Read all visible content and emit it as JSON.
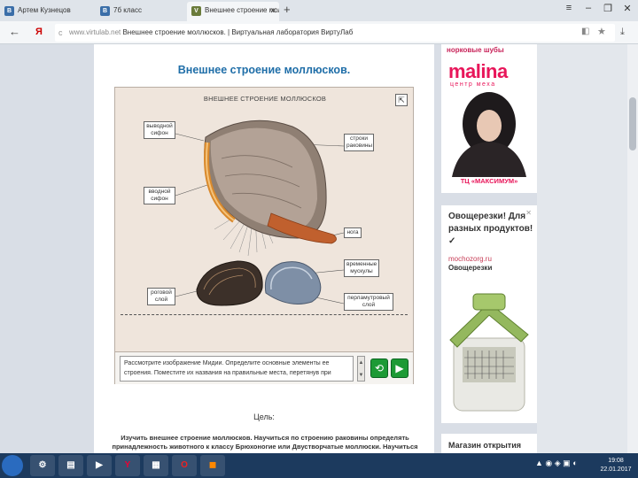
{
  "browser": {
    "tabs": [
      {
        "label": "Артем Кузнецов"
      },
      {
        "label": "7б класс"
      },
      {
        "label": "Внешнее строение молл"
      }
    ],
    "new_tab": "+",
    "url_domain": "www.virtulab.net",
    "url_rest": " Внешнее строение моллюсков. | Виртуальная лаборатория ВиртуЛаб"
  },
  "page": {
    "title": "Внешнее строение моллюсков.",
    "lab": {
      "heading": "ВНЕШНЕЕ СТРОЕНИЕ МОЛЛЮСКОВ",
      "labels": {
        "exhalant": "выводной\nсифон",
        "inhalant": "вводной\nсифон",
        "growth_lines": "строки\nраковины",
        "foot": "нога",
        "muscles": "временные\nмускулы",
        "horny": "роговой\nслой",
        "pearl": "перламутровый\nслой"
      },
      "instruction": "Рассмотрите изображение Мидии. Определите основные элементы ее строения. Поместите их названия на правильные места, перетянув при"
    },
    "goal": "Цель:",
    "task": "Изучить внешнее строение моллюсков. Научиться по строению раковины определять принадлежность животного к классу Брюхоногие или Двустворчатые моллюски. Научиться"
  },
  "ads": {
    "ad1_top": "норковые шубы",
    "ad1_brand": "malina",
    "ad1_sub": "центр меха",
    "ad1_bottom": "ТЦ «МАКСИМУМ»",
    "ad2_title": "Овощерезки! Для разных продуктов! ✓",
    "ad2_link": "mochozorg.ru",
    "ad2_link2": "Овощерезки",
    "ad3_title": "Магазин открытия"
  },
  "taskbar": {
    "clock_time": "19:08",
    "clock_date": "22.01.2017"
  }
}
